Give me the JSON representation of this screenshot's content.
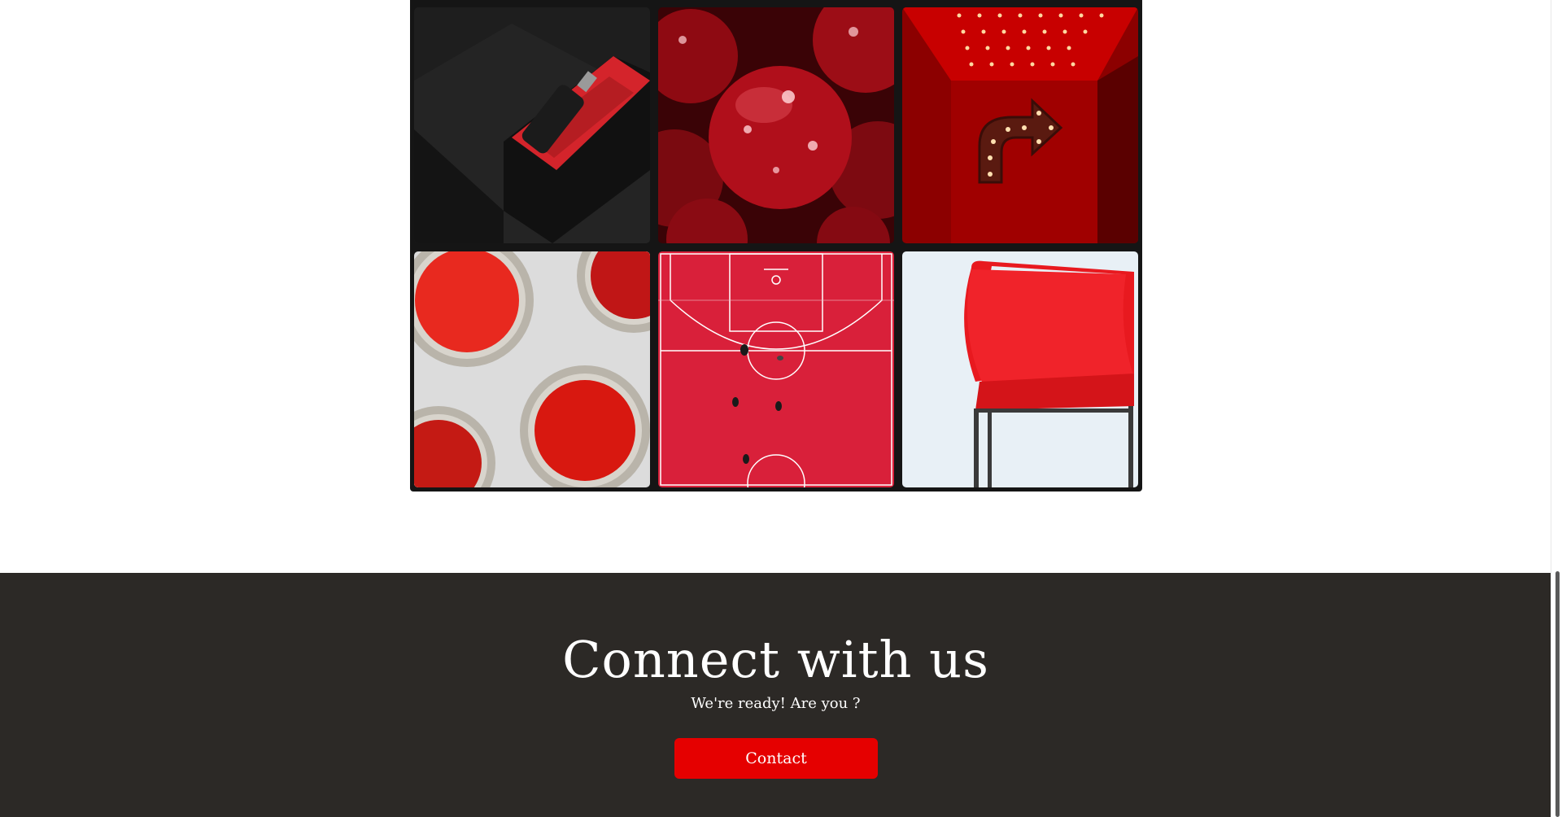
{
  "gallery": {
    "tiles": [
      {
        "name": "perfume-bottle-box-image"
      },
      {
        "name": "cherries-image"
      },
      {
        "name": "neon-arrow-sign-image"
      },
      {
        "name": "paint-cans-image"
      },
      {
        "name": "basketball-court-image"
      },
      {
        "name": "red-chair-image"
      }
    ]
  },
  "footer": {
    "title": "Connect with us",
    "subtitle": "We're ready! Are you ?",
    "contact_label": "Contact"
  },
  "colors": {
    "accent": "#e50000",
    "footer_bg": "#2c2926",
    "gallery_bg": "#151515"
  }
}
